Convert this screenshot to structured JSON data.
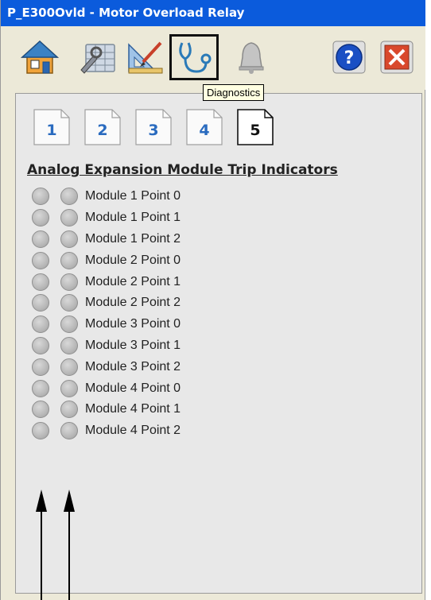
{
  "window": {
    "title": "P_E300Ovld - Motor Overload Relay"
  },
  "toolbar": {
    "buttons": [
      {
        "name": "home-icon"
      },
      {
        "name": "maintenance-icon"
      },
      {
        "name": "engineering-icon"
      },
      {
        "name": "diagnostics-icon",
        "active": true
      },
      {
        "name": "alarm-bell-icon"
      }
    ],
    "tooltip": "Diagnostics"
  },
  "tabs": [
    {
      "label": "1"
    },
    {
      "label": "2"
    },
    {
      "label": "3"
    },
    {
      "label": "4"
    },
    {
      "label": "5",
      "active": true
    }
  ],
  "section": {
    "title": "Analog Expansion Module Trip Indicators",
    "rows": [
      {
        "label": "Module 1 Point 0"
      },
      {
        "label": "Module 1 Point 1"
      },
      {
        "label": "Module 1 Point 2"
      },
      {
        "label": "Module 2 Point 0"
      },
      {
        "label": "Module 2 Point 1"
      },
      {
        "label": "Module 2 Point 2"
      },
      {
        "label": "Module 3 Point 0"
      },
      {
        "label": "Module 3 Point 1"
      },
      {
        "label": "Module 3 Point 2"
      },
      {
        "label": "Module 4 Point 0"
      },
      {
        "label": "Module 4 Point 1"
      },
      {
        "label": "Module 4 Point 2"
      }
    ]
  },
  "colors": {
    "title_bar": "#0b5bdc",
    "tab_number": "#2a6bbf",
    "indicator_off": "#bcbcbc",
    "help_button": "#1a4fc4",
    "close_button": "#d9482c"
  }
}
